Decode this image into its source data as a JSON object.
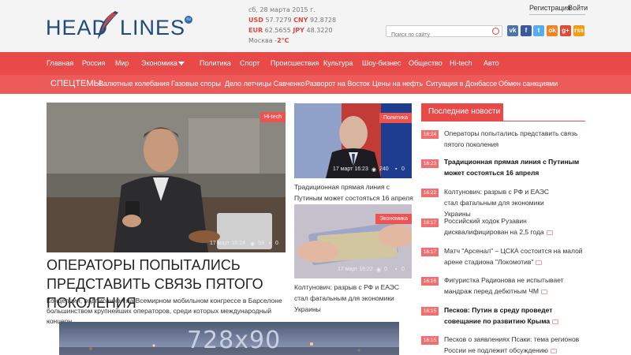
{
  "header": {
    "logo_left": "HEAD",
    "logo_right": "LINES",
    "logo_badge": "ru",
    "date": "сб, 28 марта 2015 г.",
    "rates_row1": [
      {
        "code": "USD",
        "value": "57.7279"
      },
      {
        "code": "CNY",
        "value": "92.8728"
      }
    ],
    "rates_row2": [
      {
        "code": "EUR",
        "value": "62.5655"
      },
      {
        "code": "JPY",
        "value": "48.3220"
      }
    ],
    "weather_city": "Москва -",
    "weather_temp": "2°C",
    "register_label": "Регистрация",
    "login_label": "Войти",
    "search_placeholder": "Поиск по сайту",
    "social": [
      {
        "icon": "vk-icon",
        "glyph": "vk",
        "color": "#4c75a3"
      },
      {
        "icon": "facebook-icon",
        "glyph": "f",
        "color": "#3b5998"
      },
      {
        "icon": "twitter-icon",
        "glyph": "t",
        "color": "#55acee"
      },
      {
        "icon": "odnoklassniki-icon",
        "glyph": "ok",
        "color": "#f58220"
      },
      {
        "icon": "googleplus-icon",
        "glyph": "g+",
        "color": "#dd4b39"
      },
      {
        "icon": "rss-icon",
        "glyph": "rss",
        "color": "#f39c12"
      }
    ]
  },
  "nav": {
    "items": [
      "Главная",
      "Россия",
      "Мир",
      "Экономика",
      "Политика",
      "Спорт",
      "Происшествия",
      "Культура",
      "Шоу-бизнес",
      "Общество",
      "Hi-tech",
      "Авто"
    ]
  },
  "subnav": {
    "label": "СПЕЦТЕМЫ:",
    "items": [
      "Валютные колебания",
      "Газовые споры",
      "Дело летчицы Савченко",
      "Разворот на Восток",
      "Цены на нефть",
      "Ситуация в Донбассе",
      "Обмен санкциями"
    ]
  },
  "main_story": {
    "tag": "Hi-tech",
    "date": "17 март 16:24",
    "views": "53",
    "comments": "0",
    "title": "ОПЕРАТОРЫ ПОПЫТАЛИСЬ ПРЕДСТАВИТЬ СВЯЗЬ ПЯТОГО ПОКОЛЕНИЯ",
    "description": "Концепция, подписанная на Всемирном мобильном конгрессе в Барселоне большинством крупнейших операторов, среди которых международный концерн"
  },
  "side_stories": [
    {
      "tag": "Политика",
      "date": "17 март 16:23",
      "views": "240",
      "comments": "0",
      "caption": "Традиционная прямая линия с Путиным может состояться 16 апреля"
    },
    {
      "tag": "Экономика",
      "date": "17 март 16:22",
      "views": "0",
      "comments": "0",
      "caption": "Колтунович: разрыв с РФ и ЕАЭС стал фатальным для экономики Украины"
    }
  ],
  "ad": {
    "label": "728x90"
  },
  "latest": {
    "title": "Последние новости",
    "items": [
      {
        "time": "16:24",
        "text": "Операторы попытались представить связь пятого поколения",
        "bold": false,
        "icon": false
      },
      {
        "time": "16:23",
        "text": "Традиционная прямая линия с Путиным может состояться 16 апреля",
        "bold": true,
        "icon": false
      },
      {
        "time": "16:22",
        "text": "Колтунович: разрыв с РФ и ЕАЭС стал фатальным для экономики Украины",
        "bold": false,
        "icon": false
      },
      {
        "time": "16:17",
        "text": "Российский ходок Рузавин дисквалифицирован на 2,5 года",
        "bold": false,
        "icon": true
      },
      {
        "time": "16:17",
        "text": "Матч \"Арсенал\" – ЦСКА состоится на малой арене стадиона \"Локомотив\"",
        "bold": false,
        "icon": true
      },
      {
        "time": "16:16",
        "text": "Фигуристка Радионова не испытывает мандраж перед дебютным ЧМ",
        "bold": false,
        "icon": true
      },
      {
        "time": "16:15",
        "text": "Песков: Путин в среду проведет совещание по развитию Крыма",
        "bold": true,
        "icon": true
      },
      {
        "time": "16:15",
        "text": "Песков о заявлениях Псаки: тема регионов России не подлежит обсуждению",
        "bold": false,
        "icon": true
      }
    ]
  }
}
